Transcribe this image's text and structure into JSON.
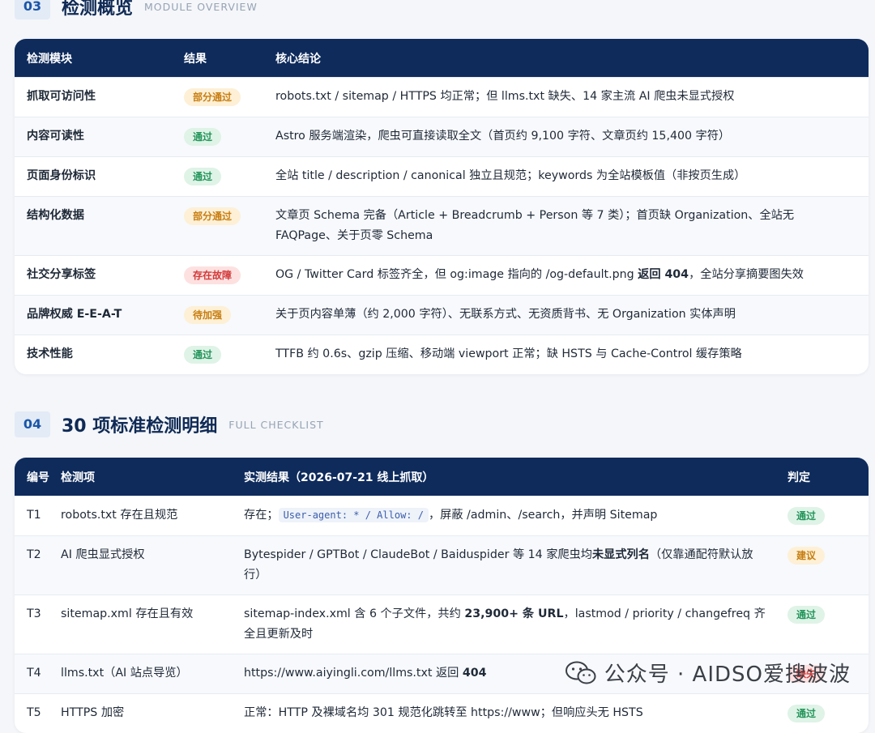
{
  "section3": {
    "num": "03",
    "title": "检测概览",
    "subtitle": "MODULE OVERVIEW",
    "headers": [
      "检测模块",
      "结果",
      "核心结论"
    ],
    "rows": [
      {
        "module": "抓取可访问性",
        "result": "部分通过",
        "status": "warn",
        "conclusion": "robots.txt / sitemap / HTTPS 均正常；但 llms.txt 缺失、14 家主流 AI 爬虫未显式授权"
      },
      {
        "module": "内容可读性",
        "result": "通过",
        "status": "pass",
        "conclusion": "Astro 服务端渲染，爬虫可直接读取全文（首页约 9,100 字符、文章页约 15,400 字符）"
      },
      {
        "module": "页面身份标识",
        "result": "通过",
        "status": "pass",
        "conclusion": "全站 title / description / canonical 独立且规范；keywords 为全站模板值（非按页生成）"
      },
      {
        "module": "结构化数据",
        "result": "部分通过",
        "status": "warn",
        "conclusion": "文章页 Schema 完备（Article + Breadcrumb + Person 等 7 类）；首页缺 Organization、全站无 FAQPage、关于页零 Schema"
      },
      {
        "module": "社交分享标签",
        "result": "存在故障",
        "status": "fail",
        "conclusion_pre": "OG / Twitter Card 标签齐全，但 og:image 指向的 /og-default.png ",
        "conclusion_bold": "返回 404",
        "conclusion_post": "，全站分享摘要图失效"
      },
      {
        "module": "品牌权威 E-E-A-T",
        "result": "待加强",
        "status": "warn",
        "conclusion": "关于页内容单薄（约 2,000 字符）、无联系方式、无资质背书、无 Organization 实体声明"
      },
      {
        "module": "技术性能",
        "result": "通过",
        "status": "pass",
        "conclusion": "TTFB 约 0.6s、gzip 压缩、移动端 viewport 正常；缺 HSTS 与 Cache-Control 缓存策略"
      }
    ]
  },
  "section4": {
    "num": "04",
    "title": "30 项标准检测明细",
    "subtitle": "FULL CHECKLIST",
    "headers": [
      "编号",
      "检测项",
      "实测结果（2026-07-21 线上抓取）",
      "判定"
    ],
    "rows": [
      {
        "id": "T1",
        "item": "robots.txt 存在且规范",
        "pre": "存在；",
        "code": "User-agent: * / Allow: /",
        "post": "，屏蔽 /admin、/search，并声明 Sitemap",
        "verdict": "通过",
        "status": "pass"
      },
      {
        "id": "T2",
        "item": "AI 爬虫显式授权",
        "pre": "Bytespider / GPTBot / ClaudeBot / Baiduspider 等 14 家爬虫均",
        "bold": "未显式列名",
        "post": "（仅靠通配符默认放行）",
        "verdict": "建议",
        "status": "warn"
      },
      {
        "id": "T3",
        "item": "sitemap.xml 存在且有效",
        "pre": "sitemap-index.xml 含 6 个子文件，共约 ",
        "bold": "23,900+ 条 URL",
        "post": "，lastmod / priority / changefreq 齐全且更新及时",
        "verdict": "通过",
        "status": "pass"
      },
      {
        "id": "T4",
        "item": "llms.txt（AI 站点导览）",
        "pre": "https://www.aiyingli.com/llms.txt 返回 ",
        "bold": "404",
        "post": "",
        "verdict": "缺失",
        "status": "fail"
      },
      {
        "id": "T5",
        "item": "HTTPS 加密",
        "pre": "正常：HTTP 及裸域名均 301 规范化跳转至 https://www；但响应头无 HSTS",
        "bold": "",
        "post": "",
        "verdict": "通过",
        "status": "pass"
      }
    ]
  },
  "watermark": {
    "text": "公众号 · AIDSO爱搜波波",
    "icon": "wechat-icon"
  },
  "colors": {
    "header_bg": "#0e2b5c",
    "pass": "#23955a",
    "warn": "#c77d10",
    "fail": "#d23a3a"
  }
}
